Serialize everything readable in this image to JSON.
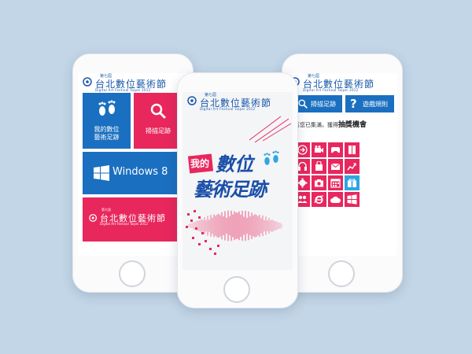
{
  "colors": {
    "accent_blue": "#1a6fc0",
    "accent_pink": "#e8275d",
    "background": "#c3d6e7"
  },
  "logo": {
    "small": "第七屆",
    "title": "台北數位藝術節",
    "english": "Digital Art Festival Taipei 2012"
  },
  "left_phone": {
    "tile_footprints_label": "我的數位\n藝術足跡",
    "tile_scan_label": "掃描足跡",
    "tile_windows_label": "Windows 8"
  },
  "center_phone": {
    "badge": "我的",
    "headline_line1": "數位",
    "headline_line2": "藝術足跡"
  },
  "right_phone": {
    "scan_button": "掃描足跡",
    "rules_button": "遊戲規則",
    "message_prefix": "恭喜您已集滿，獲得",
    "message_highlight": "抽獎機會",
    "grid_icons": [
      "arrow-right-icon",
      "video-camera-icon",
      "gamepad-icon",
      "book-icon",
      "headphones-icon",
      "shopping-bag-icon",
      "mail-icon",
      "chart-icon",
      "gear-icon",
      "camera-icon",
      "calendar-icon",
      "gift-icon",
      "people-icon",
      "internet-explorer-icon",
      "cloud-icon",
      "windows-icon"
    ]
  }
}
